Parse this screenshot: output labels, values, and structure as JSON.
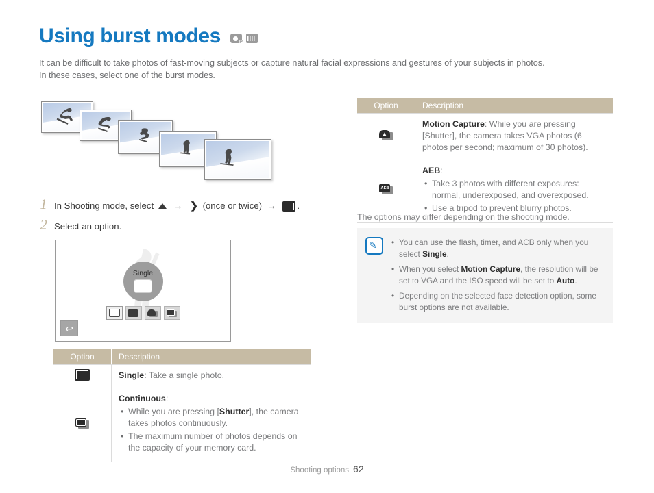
{
  "header": {
    "title": "Using burst modes",
    "mode_icons": [
      "camera-program-icon",
      "movie-icon"
    ],
    "intro_line1": "It can be difficult to take photos of fast-moving subjects or capture natural facial expressions and gestures of your subjects in photos.",
    "intro_line2": "In these cases, select one of the burst modes."
  },
  "illustration": {
    "name": "burst-photo-sequence",
    "frame_count": 5
  },
  "steps": [
    {
      "number": "1",
      "pre": "In Shooting mode, select",
      "mid": "(once or twice)",
      "post": ".",
      "icons": [
        "up-triangle-icon",
        "arrow-right",
        "chevron-right-icon",
        "arrow-right",
        "burst-rect-icon"
      ]
    },
    {
      "number": "2",
      "pre": "Select an option.",
      "mid": "",
      "post": "",
      "icons": []
    }
  ],
  "lcd": {
    "bubble_label": "Single",
    "options": [
      {
        "name": "option-single",
        "selected": true
      },
      {
        "name": "option-continuous",
        "selected": false
      },
      {
        "name": "option-motion-capture",
        "selected": false
      },
      {
        "name": "option-aeb",
        "selected": false
      }
    ],
    "back_label": "↩"
  },
  "table_left": {
    "headers": {
      "option": "Option",
      "description": "Description"
    },
    "rows": [
      {
        "icon": "single-icon",
        "term": "Single",
        "after_term": ": Take a single photo.",
        "bullets": []
      },
      {
        "icon": "continuous-icon",
        "term": "Continuous",
        "after_term": ":",
        "bullets": [
          "While you are pressing [Shutter], the camera takes photos continuously.",
          "The maximum number of photos depends on the capacity of your memory card."
        ]
      }
    ]
  },
  "table_right": {
    "headers": {
      "option": "Option",
      "description": "Description"
    },
    "rows": [
      {
        "icon": "motion-capture-icon",
        "term": "Motion Capture",
        "after_term": ": While you are pressing [Shutter], the camera takes VGA photos (6 photos per second; maximum of 30 photos).",
        "bullets": []
      },
      {
        "icon": "aeb-icon",
        "term": "AEB",
        "after_term": ":",
        "bullets": [
          "Take 3 photos with different exposures: normal, underexposed, and overexposed.",
          "Use a tripod to prevent blurry photos."
        ]
      }
    ]
  },
  "note_caption": "The options may differ depending on the shooting mode.",
  "note": {
    "icon": "note-feather-icon",
    "bullets": [
      "You can use the flash, timer, and ACB only when you select Single.",
      "When you select Motion Capture, the resolution will be set to VGA and the ISO speed will be set to Auto.",
      "Depending on the selected face detection option, some burst options are not available."
    ]
  },
  "footer": {
    "section": "Shooting options",
    "page": "62"
  },
  "colors": {
    "title_blue": "#1579c0",
    "table_header": "#c6bba4",
    "body_text": "#6d6e70",
    "note_bg": "#f4f4f4",
    "step_number": "#c3b79f"
  }
}
